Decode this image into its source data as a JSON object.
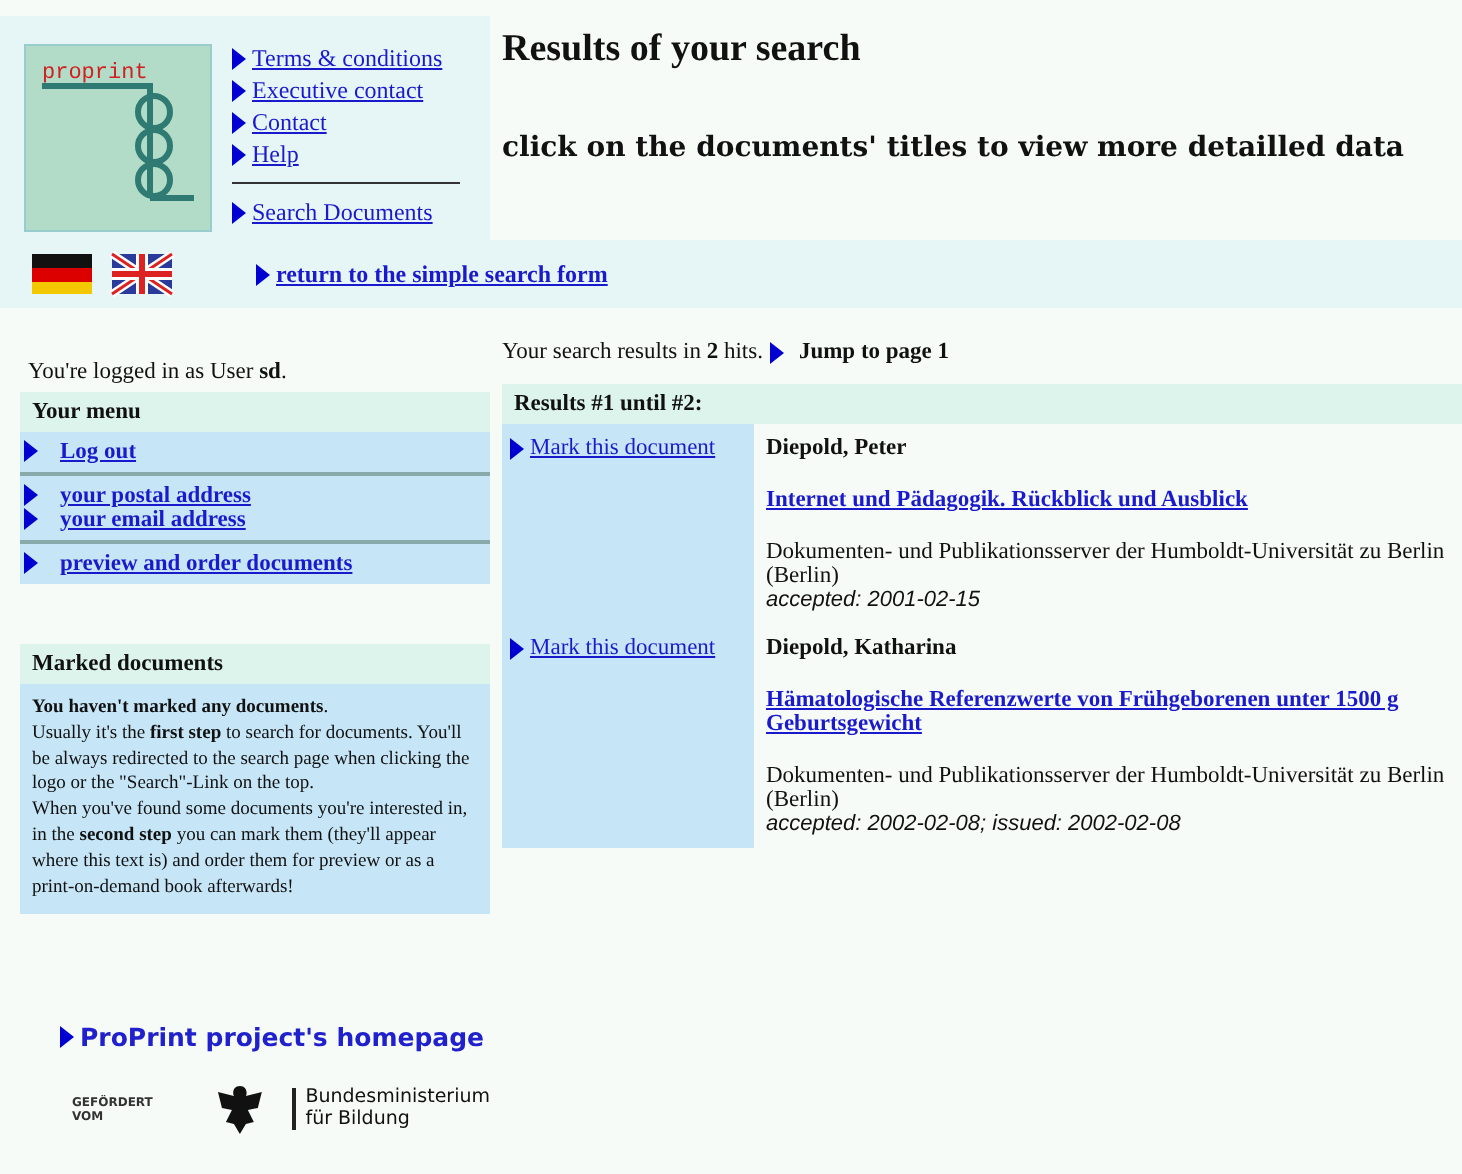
{
  "logo": {
    "text": "proprint"
  },
  "nav_links": [
    "Terms & conditions",
    "Executive contact",
    "Contact",
    "Help"
  ],
  "search_link": "Search Documents",
  "languages": [
    {
      "kind": "german"
    },
    {
      "kind": "english"
    }
  ],
  "return_link": "return to the simple search form",
  "heading": "Results of your search",
  "subheading": "click on the documents' titles to view more detailled data",
  "login": "You're logged in as User **sd**.",
  "menu": {
    "title": "Your menu",
    "groups": [
      [
        "Log out"
      ],
      [
        "your postal address",
        "your email address"
      ],
      [
        "preview and order documents"
      ]
    ]
  },
  "marked": {
    "title": "Marked documents",
    "paragraphs": [
      "**You haven't marked any documents**.",
      "Usually it's the **first step** to search for documents. You'll be always redirected to the search page when clicking the logo or the \"Search\"-Link on the top.",
      "When you've found some documents you're interested in, in the **second step** you can mark them (they'll appear where this text is) and order them for preview or as a print-on-demand book afterwards!"
    ]
  },
  "homepage_link": "ProPrint project's homepage",
  "funding": {
    "label": "GEFÖRDERT VOM",
    "ministry": [
      "Bundesministerium",
      "für Bildung"
    ]
  },
  "summary": "Your search results in **2** hits.",
  "jump_link": "Jump to page 1",
  "results": {
    "title": "Results #1 until #2:",
    "items": [
      {
        "mark_link": "Mark this document",
        "author": "Diepold, Peter",
        "title": "Internet und Pädagogik. Rückblick und Ausblick",
        "publisher": "Dokumenten- und Publikationsserver der Humboldt-Universität zu Berlin (Berlin)",
        "dates": "accepted: 2001-02-15"
      },
      {
        "mark_link": "Mark this document",
        "author": "Diepold, Katharina",
        "title": "Hämatologische Referenzwerte von Frühgeborenen unter 1500 g Geburtsgewicht",
        "publisher": "Dokumenten- und Publikationsserver der Humboldt-Universität zu Berlin (Berlin)",
        "dates": "accepted: 2002-02-08; issued: 2002-02-08"
      }
    ]
  }
}
